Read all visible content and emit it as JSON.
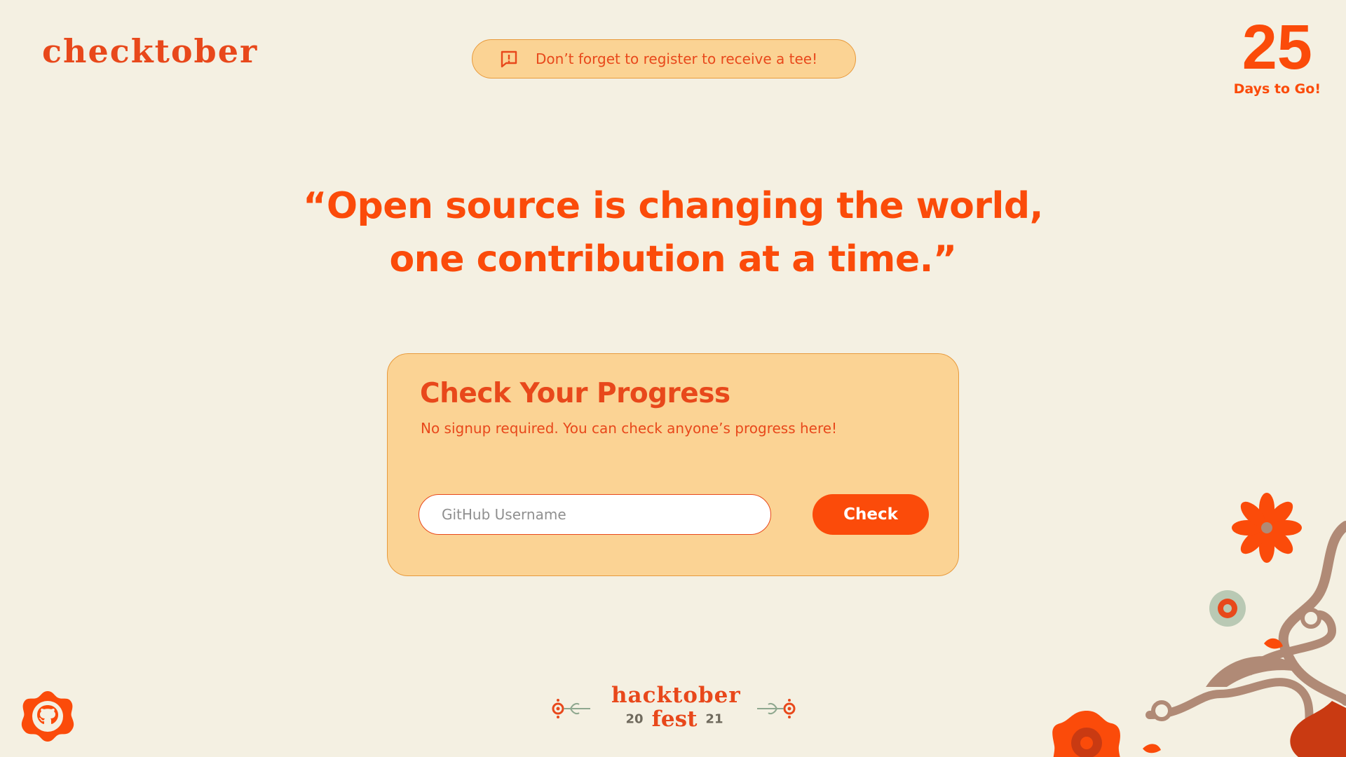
{
  "header": {
    "logo_text": "checktober",
    "banner_text": "Don’t forget to register to receive a tee!",
    "banner_icon": "message-alert-icon",
    "countdown_number": "25",
    "countdown_label": "Days to Go!"
  },
  "hero": {
    "quote_line1": "“Open source is changing the world,",
    "quote_line2": "one contribution at a time.”"
  },
  "progress_card": {
    "title": "Check Your Progress",
    "subtitle": "No signup required. You can check anyone’s progress here!",
    "input_placeholder": "GitHub Username",
    "input_value": "",
    "button_label": "Check"
  },
  "footer": {
    "github_icon": "github-icon",
    "event_name": "hacktober",
    "event_fest": "fest",
    "year_left": "20",
    "year_right": "21"
  },
  "colors": {
    "background": "#f4f0e2",
    "accent": "#fb4b0a",
    "card": "#fbd394",
    "text_orange": "#e8481b"
  }
}
